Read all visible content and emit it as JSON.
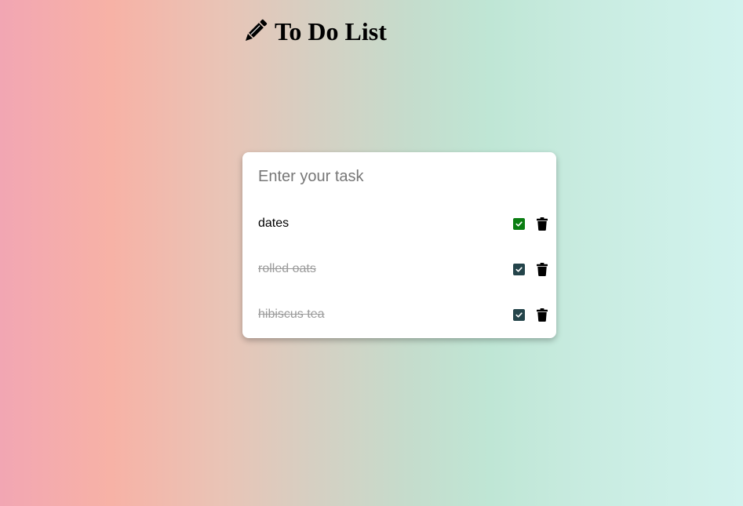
{
  "header": {
    "title": "To Do List",
    "icon": "pencil-icon"
  },
  "input": {
    "placeholder": "Enter your task",
    "value": ""
  },
  "tasks": [
    {
      "text": "dates",
      "completed": false,
      "checkbox_checked": true
    },
    {
      "text": "rolled oats",
      "completed": true,
      "checkbox_checked": true
    },
    {
      "text": "hibiscus tea",
      "completed": true,
      "checkbox_checked": true
    }
  ],
  "colors": {
    "check_active": "#0a7d12",
    "check_done": "#24444a",
    "done_text": "#9a9a9a"
  }
}
